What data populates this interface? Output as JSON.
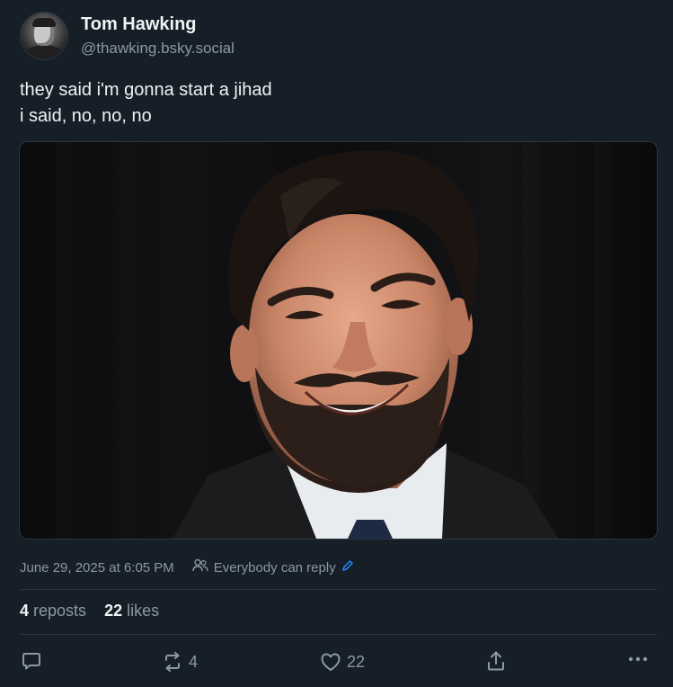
{
  "author": {
    "name": "Tom Hawking",
    "handle": "@thawking.bsky.social"
  },
  "post": {
    "lines": [
      "they said i'm gonna start a jihad",
      "i said, no, no, no"
    ]
  },
  "meta": {
    "timestamp": "June 29, 2025 at 6:05 PM",
    "reply_setting": "Everybody can reply"
  },
  "stats": {
    "reposts_count": "4",
    "reposts_label": "reposts",
    "likes_count": "22",
    "likes_label": "likes"
  },
  "actions": {
    "reply_count": "",
    "repost_count": "4",
    "like_count": "22"
  },
  "icons": {
    "reply": "reply-icon",
    "repost": "repost-icon",
    "like": "heart-icon",
    "share": "share-icon",
    "more": "more-icon",
    "people": "people-icon",
    "edit": "pencil-icon"
  },
  "colors": {
    "background": "#161e27",
    "text": "#f1f3f5",
    "muted": "#8b98a5",
    "accent": "#208bfe"
  }
}
